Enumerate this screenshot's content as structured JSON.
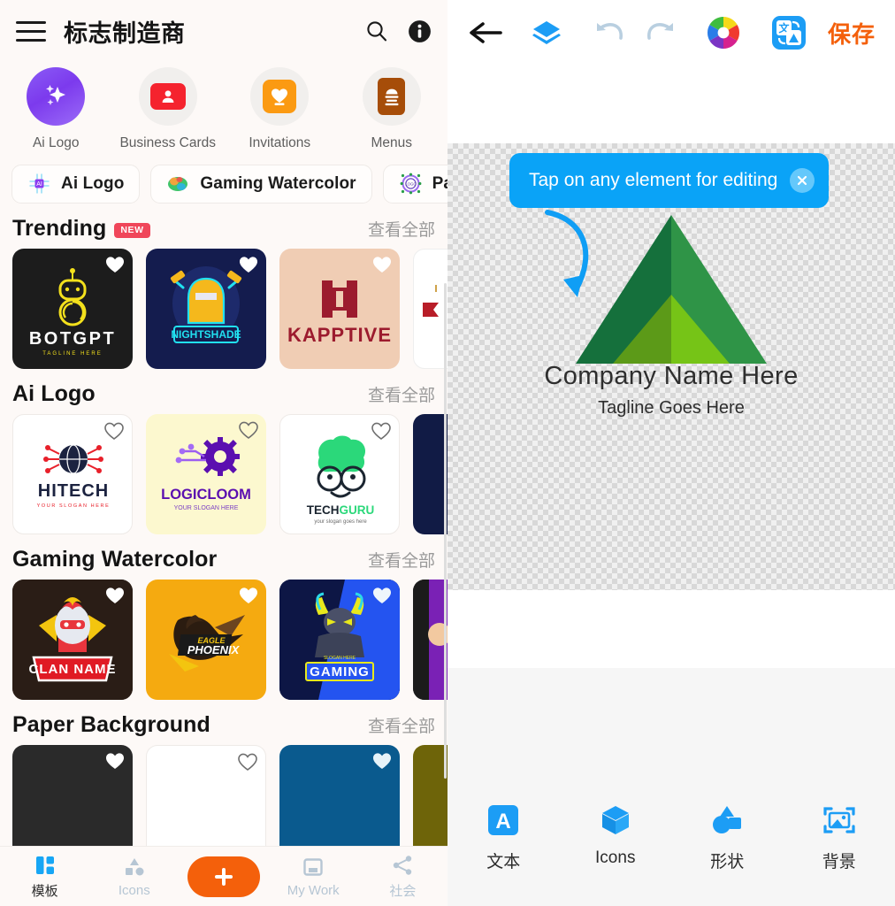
{
  "left_panel": {
    "header": {
      "title": "标志制造商",
      "menu_icon": "hamburger-icon",
      "search_icon": "search-icon",
      "info_icon": "info-icon"
    },
    "categories": [
      {
        "label": "Ai Logo",
        "icon": "sparkles-icon"
      },
      {
        "label": "Business Cards",
        "icon": "contact-card-icon"
      },
      {
        "label": "Invitations",
        "icon": "heart-card-icon"
      },
      {
        "label": "Menus",
        "icon": "menu-document-icon"
      }
    ],
    "chips": [
      {
        "label": "Ai Logo",
        "icon": "ai-chip-icon"
      },
      {
        "label": "Gaming Watercolor",
        "icon": "watercolor-gamepad-icon"
      },
      {
        "label": "Paper",
        "icon": "logo-circle-icon"
      }
    ],
    "sections": [
      {
        "title": "Trending",
        "badge": "NEW",
        "see_all": "查看全部",
        "cards": [
          {
            "name": "BOTGPT",
            "tagline": "TAGLINE HERE",
            "bg": "#1c1c1c",
            "accent": "#f3e01c",
            "favorited": true
          },
          {
            "name": "NIGHTSHADE",
            "tagline": "",
            "bg": "#141c4e",
            "accent": "#f5b81c",
            "favorited": true
          },
          {
            "name": "KAPPTIVE",
            "tagline": "",
            "bg": "#f0cdb4",
            "accent": "#9c1b2e",
            "favorited": true
          },
          {
            "name": "",
            "tagline": "",
            "bg": "#ffffff",
            "accent": "#b81d28",
            "favorited": false
          }
        ]
      },
      {
        "title": "Ai Logo",
        "badge": "",
        "see_all": "查看全部",
        "cards": [
          {
            "name": "HITECH",
            "tagline": "YOUR SLOGAN HERE",
            "bg": "#ffffff",
            "accent": "#e8202a",
            "favorited": false
          },
          {
            "name": "LOGICLOOM",
            "tagline": "YOUR SLOGAN HERE",
            "bg": "#fcf8cf",
            "accent": "#6610b5",
            "favorited": false
          },
          {
            "name": "TECHGURU",
            "tagline": "your slogan goes here",
            "bg": "#ffffff",
            "accent": "#1fd46f",
            "favorited": false
          },
          {
            "name": "",
            "tagline": "",
            "bg": "#111b45",
            "accent": "#ffffff",
            "favorited": false
          }
        ]
      },
      {
        "title": "Gaming Watercolor",
        "badge": "",
        "see_all": "查看全部",
        "cards": [
          {
            "name": "CLAN NAME",
            "tagline": "",
            "bg": "#2a1d16",
            "accent": "#e61b27",
            "favorited": true
          },
          {
            "name": "EAGLE PHOENIX",
            "tagline": "",
            "bg": "#f5aa10",
            "accent": "#241a12",
            "favorited": true
          },
          {
            "name": "GAMING",
            "tagline": "SLOGAN HERE",
            "bg": "#0d1645",
            "accent": "#2454f0",
            "favorited": true
          },
          {
            "name": "",
            "tagline": "",
            "bg": "#1b1b1b",
            "accent": "#7a21b5",
            "favorited": false
          }
        ]
      },
      {
        "title": "Paper Background",
        "badge": "",
        "see_all": "查看全部",
        "cards": [
          {
            "name": "",
            "tagline": "",
            "bg": "#2a2a2a",
            "accent": "#ffffff",
            "favorited": true
          },
          {
            "name": "",
            "tagline": "",
            "bg": "#ffffff",
            "accent": "#888888",
            "favorited": false
          },
          {
            "name": "",
            "tagline": "",
            "bg": "#0a5a8e",
            "accent": "#ffffff",
            "favorited": true
          },
          {
            "name": "",
            "tagline": "",
            "bg": "#6e6409",
            "accent": "#ffffff",
            "favorited": false
          }
        ]
      }
    ],
    "bottom_nav": [
      {
        "label": "模板",
        "icon": "templates-icon",
        "active": true
      },
      {
        "label": "Icons",
        "icon": "shapes-icon",
        "active": false
      },
      {
        "label": "",
        "icon": "plus-icon",
        "active": false
      },
      {
        "label": "My Work",
        "icon": "inbox-icon",
        "active": false
      },
      {
        "label": "社会",
        "icon": "share-icon",
        "active": false
      }
    ]
  },
  "right_panel": {
    "toolbar": {
      "back_icon": "back-arrow-icon",
      "layers_icon": "layers-icon",
      "undo_icon": "undo-icon",
      "redo_icon": "redo-icon",
      "color_wheel_icon": "color-wheel-icon",
      "translate_icon": "translate-icon",
      "save_label": "保存"
    },
    "tooltip": {
      "text": "Tap on any element for editing",
      "close_icon": "close-icon"
    },
    "logo": {
      "company_name": "Company Name Here",
      "tagline": "Tagline Goes Here",
      "mark_icon": "mountain-triangle-icon",
      "color_dark_green": "#15703c",
      "color_mid_green": "#2f9447",
      "color_light_green": "#76c417",
      "color_olive_green": "#5c9a18"
    },
    "bottom_tools": [
      {
        "label": "文本",
        "icon": "text-icon"
      },
      {
        "label": "Icons",
        "icon": "cube-icon"
      },
      {
        "label": "形状",
        "icon": "shapes-icon"
      },
      {
        "label": "背景",
        "icon": "image-frame-icon"
      }
    ]
  },
  "colors": {
    "accent_blue": "#0aa3f7",
    "accent_orange": "#f4600b",
    "badge_red": "#f0465a",
    "panel_bg": "#fdf9f7"
  }
}
